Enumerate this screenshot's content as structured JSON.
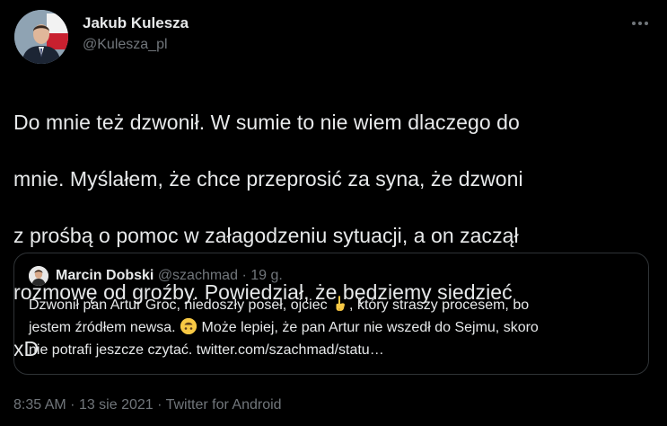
{
  "author": {
    "display_name": "Jakub Kulesza",
    "handle": "@Kulesza_pl"
  },
  "more_button_icon": "more-horizontal-icon",
  "tweet": {
    "text_lines": [
      "Do mnie też dzwonił. W sumie to nie wiem dlaczego do",
      "mnie. Myślałem, że chce przeprosić za syna, że dzwoni",
      "z prośbą o pomoc w załagodzeniu sytuacji, a on zaczął",
      "rozmowę od groźby. Powiedział, że będziemy siedzieć",
      "xD"
    ]
  },
  "quote": {
    "display_name": "Marcin Dobski",
    "handle": "@szachmad",
    "separator": "·",
    "time": "19 g.",
    "line1_a": "Dzwonił pan Artur Groc, niedoszły poseł, ojciec",
    "line1_emoji": "backhand-index-pointing-down-icon",
    "line1_b": ", który straszy procesem, bo",
    "line2_a": "jestem źródłem newsa.",
    "line2_emoji": "upside-down-face-icon",
    "line2_b": " Może lepiej, że pan Artur nie wszedł do Sejmu, skoro",
    "line3": "nie potrafi jeszcze czytać. twitter.com/szachmad/statu…"
  },
  "meta": {
    "time": "8:35 AM",
    "sep1": "·",
    "date": "13 sie 2021",
    "sep2": "·",
    "source": "Twitter for Android"
  },
  "colors": {
    "background": "#000000",
    "primary_text": "#e7e9ea",
    "secondary_text": "#71767b",
    "border": "#2f3336"
  }
}
